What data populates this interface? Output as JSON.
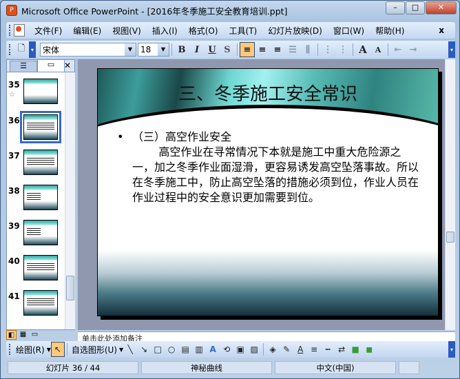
{
  "window": {
    "title": "Microsoft Office PowerPoint - [2016年冬季施工安全教育培训.ppt]",
    "min": "–",
    "max": "□",
    "close": "✕"
  },
  "menu": [
    "文件(F)",
    "编辑(E)",
    "视图(V)",
    "插入(I)",
    "格式(O)",
    "工具(T)",
    "幻灯片放映(D)",
    "窗口(W)",
    "帮助(H)"
  ],
  "menu_close": "x",
  "toolbar": {
    "font": "宋体",
    "size": "18",
    "bold": "B",
    "italic": "I",
    "underline": "U",
    "shadow": "S",
    "align_left": "≡",
    "align_center": "≡",
    "align_right": "≡",
    "grow": "A",
    "shrink": "A"
  },
  "pane": {
    "tab_outline": "☰",
    "tab_slides": "▭",
    "close": "✕",
    "thumbs": [
      {
        "num": "35"
      },
      {
        "num": "36"
      },
      {
        "num": "37"
      },
      {
        "num": "38"
      },
      {
        "num": "39"
      },
      {
        "num": "40"
      },
      {
        "num": "41"
      }
    ]
  },
  "slide": {
    "title": "三、冬季施工安全常识",
    "bullet": "•",
    "heading": "（三）高空作业安全",
    "body": "高空作业在寻常情况下本就是施工中重大危险源之一，加之冬季作业面湿滑，更容易诱发高空坠落事故。所以在冬季施工中，防止高空坠落的措施必须到位，作业人员在作业过程中的安全意识更加需要到位。"
  },
  "notes": "单击此处添加备注",
  "draw": {
    "label": "绘图(R)",
    "autoshapes": "自选图形(U)"
  },
  "status": {
    "slide": "幻灯片 36 / 44",
    "design": "神秘曲线",
    "lang": "中文(中国)"
  }
}
